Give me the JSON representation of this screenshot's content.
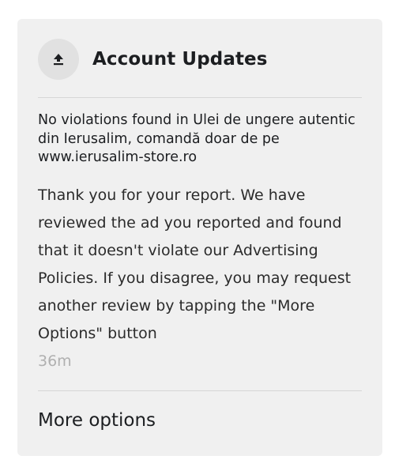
{
  "notification": {
    "header": {
      "title": "Account Updates",
      "icon": "upload-icon"
    },
    "subject": "No violations found in Ulei de ungere autentic din Ierusalim, comandă doar de pe www.ierusalim-store.ro",
    "body": "Thank you for your report. We have reviewed the ad you reported and found that it doesn't violate our Advertising Policies. If you disagree, you may request another review by tapping the \"More Options\" button",
    "timestamp": "36m",
    "more_options_label": "More options"
  },
  "colors": {
    "card_background": "#f0f0f0",
    "icon_circle": "#e1e1e1",
    "text_primary": "#1c1e21",
    "text_muted": "#b0b0b0",
    "divider": "#d6d6d6"
  }
}
